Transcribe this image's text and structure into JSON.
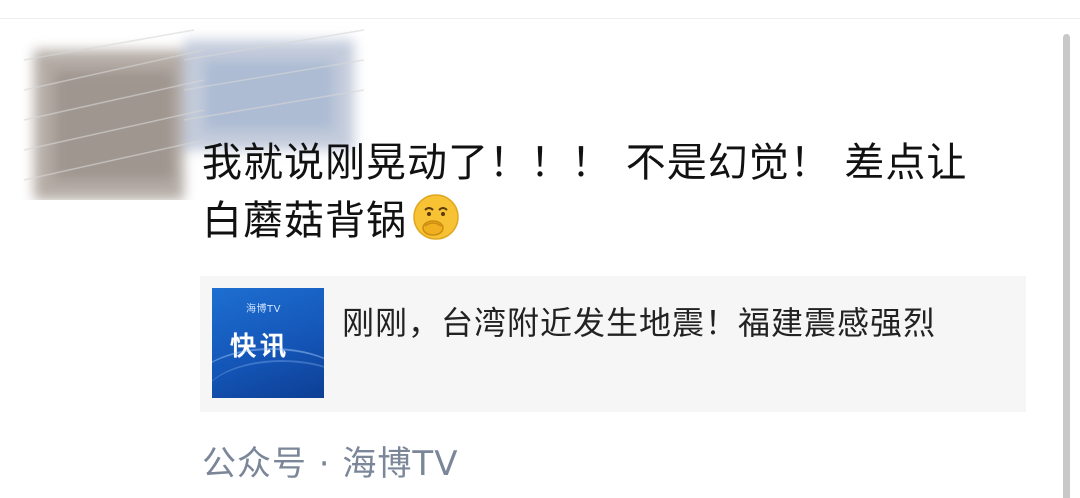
{
  "post": {
    "line1": "我就说刚晃动了！！！ 不是幻觉！ 差点让",
    "line2": "白蘑菇背锅",
    "emoji": "thinking-face-hand-over-mouth"
  },
  "article": {
    "thumbnail_text": "快讯",
    "thumbnail_logo": "海博TV",
    "title": "刚刚，台湾附近发生地震！福建震感强烈",
    "thumbnail_color": "#1a62c4"
  },
  "source": {
    "label": "公众号 · 海博TV",
    "color": "#7b8799"
  }
}
